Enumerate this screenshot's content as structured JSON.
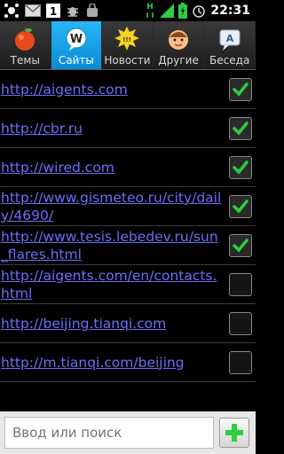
{
  "status_bar": {
    "time": "22:31",
    "notification_count": "1"
  },
  "tabs": [
    {
      "label": "Темы",
      "icon": "apple-icon",
      "active": false
    },
    {
      "label": "Сайты",
      "icon": "web-bubble-icon",
      "active": true
    },
    {
      "label": "Новости",
      "icon": "news-burst-icon",
      "active": false
    },
    {
      "label": "Другие",
      "icon": "smiley-face-icon",
      "active": false
    },
    {
      "label": "Беседа",
      "icon": "chat-bubble-icon",
      "active": false
    }
  ],
  "sites": [
    {
      "url": "http://aigents.com",
      "checked": true
    },
    {
      "url": "http://cbr.ru",
      "checked": true
    },
    {
      "url": "http://wired.com",
      "checked": true
    },
    {
      "url": "http://www.gismeteo.ru/city/daily/4690/",
      "checked": true
    },
    {
      "url": "http://www.tesis.lebedev.ru/sun_flares.html",
      "checked": true
    },
    {
      "url": "http://aigents.com/en/contacts.html",
      "checked": false
    },
    {
      "url": "http://beijing.tianqi.com",
      "checked": false
    },
    {
      "url": "http://m.tianqi.com/beijing",
      "checked": false
    }
  ],
  "input": {
    "placeholder": "Ввод или поиск"
  },
  "colors": {
    "accent": "#0a9be0",
    "link": "#6d6df8",
    "check": "#2ecc40"
  }
}
